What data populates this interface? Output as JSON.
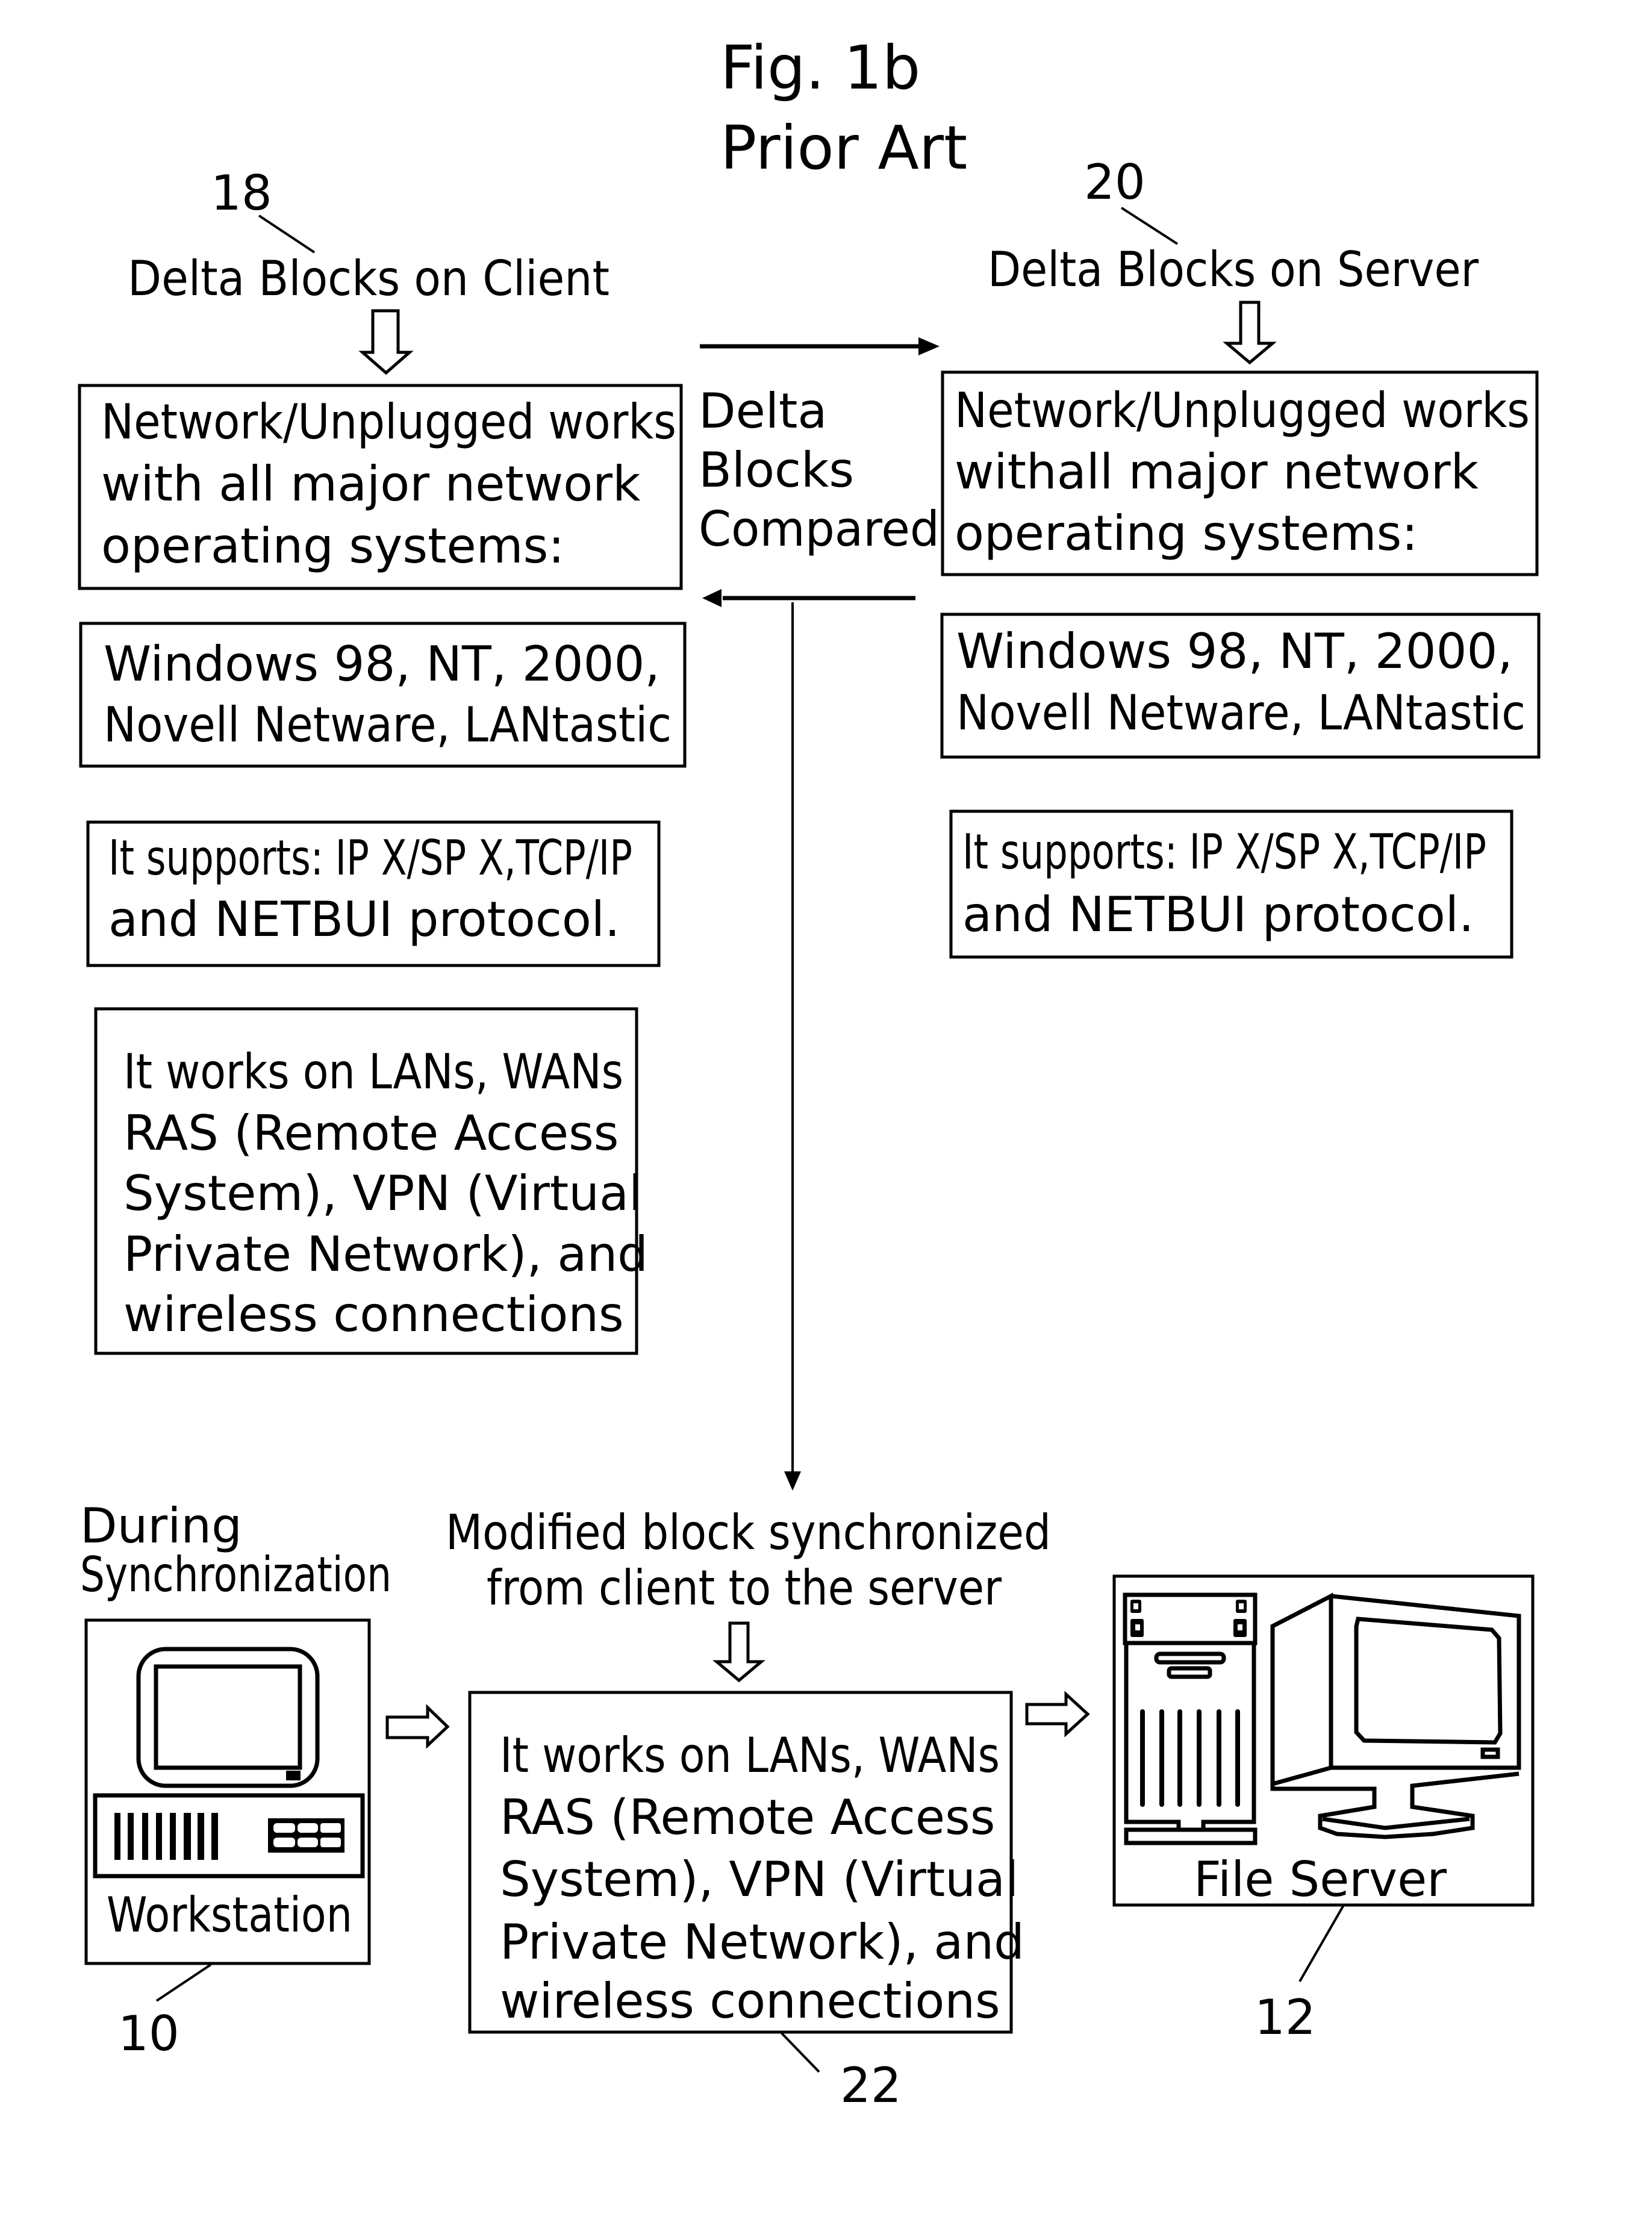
{
  "figure": {
    "title": "Fig. 1b",
    "subtitle": "Prior Art"
  },
  "client": {
    "ref": "18",
    "heading": "Delta Blocks on Client",
    "boxes": [
      {
        "lines": [
          "Network/Unplugged works",
          "with all major network",
          "operating systems:"
        ]
      },
      {
        "lines": [
          "Windows 98, NT, 2000,",
          "Novell Netware, LANtastic"
        ]
      },
      {
        "lines": [
          "It supports: IP X/SP X,TCP/IP",
          "and NETBUI protocol."
        ]
      },
      {
        "lines": [
          "It works on LANs, WANs",
          "RAS (Remote Access",
          "System), VPN (Virtual",
          "Private Network), and",
          "wireless connections"
        ]
      }
    ]
  },
  "server": {
    "ref": "20",
    "heading": "Delta Blocks on Server",
    "boxes": [
      {
        "lines": [
          "Network/Unplugged works",
          "withall major network",
          "operating systems:"
        ]
      },
      {
        "lines": [
          "Windows 98, NT, 2000,",
          "Novell Netware, LANtastic"
        ]
      },
      {
        "lines": [
          "It supports: IP X/SP X,TCP/IP",
          "and NETBUI protocol."
        ]
      }
    ]
  },
  "compare": {
    "lines": [
      "Delta",
      "Blocks",
      "Compared"
    ]
  },
  "sync": {
    "caption_lines": [
      "During",
      "Synchronization"
    ],
    "modified_lines": [
      "Modified block synchronized",
      "from client to the server"
    ],
    "middle": {
      "ref": "22",
      "lines": [
        "It works on LANs, WANs",
        "RAS (Remote Access",
        "System), VPN (Virtual",
        "Private Network), and",
        "wireless connections"
      ]
    },
    "workstation": {
      "ref": "10",
      "label": "Workstation"
    },
    "file_server": {
      "ref": "12",
      "label": "File Server"
    }
  },
  "icons": [
    "workstation-icon",
    "file-server-icon",
    "hollow-arrow-down-icon",
    "hollow-arrow-right-icon",
    "arrow-right-icon",
    "arrow-left-icon",
    "arrow-down-icon"
  ]
}
